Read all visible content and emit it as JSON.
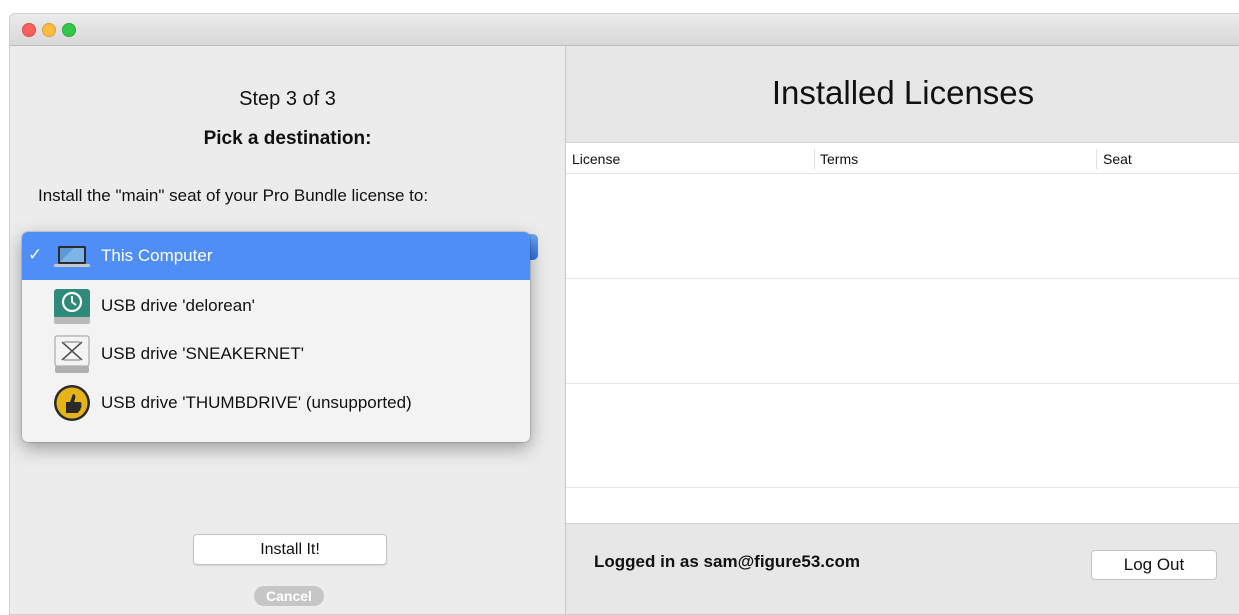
{
  "window": {
    "traffic_lights": {
      "close": "#fc605c",
      "minimize": "#fdbc40",
      "zoom": "#34c84a"
    }
  },
  "wizard": {
    "step_label": "Step 3 of 3",
    "title": "Pick a destination:",
    "instruction": "Install the \"main\" seat of your Pro Bundle license to:",
    "destinations": [
      {
        "label": "This Computer",
        "icon": "laptop-icon",
        "selected": true
      },
      {
        "label": "USB drive 'delorean'",
        "icon": "time-machine-drive-icon",
        "selected": false
      },
      {
        "label": "USB drive 'SNEAKERNET'",
        "icon": "external-drive-icon",
        "selected": false
      },
      {
        "label": "USB drive 'THUMBDRIVE' (unsupported)",
        "icon": "thumbs-up-badge-icon",
        "selected": false
      }
    ],
    "selected_check": "✓",
    "install_label": "Install It!",
    "cancel_label": "Cancel"
  },
  "licenses": {
    "title": "Installed Licenses",
    "columns": [
      "License",
      "Terms",
      "Seat"
    ],
    "rows": []
  },
  "footer": {
    "logged_in_text": "Logged in as sam@figure53.com",
    "logout_label": "Log Out"
  },
  "colors": {
    "selection": "#4f8ef7",
    "pane_background": "#ececec"
  }
}
